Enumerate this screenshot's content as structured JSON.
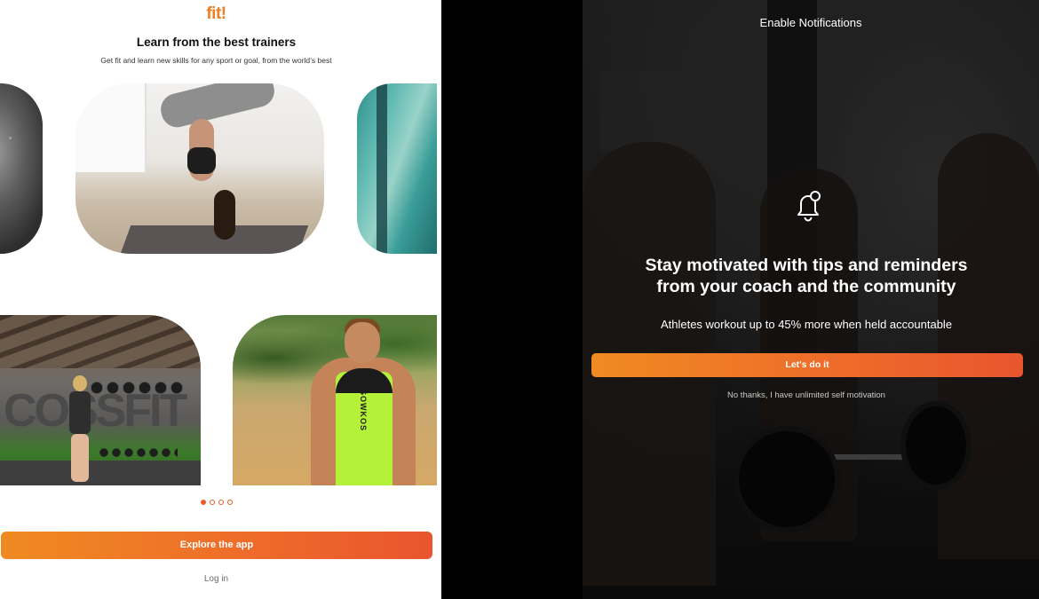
{
  "onboarding": {
    "logo": "fit!",
    "headline": "Learn from the best trainers",
    "subline": "Get fit and learn new skills for any sport or goal, from the world’s best",
    "gym_wall_text": "COSSFIT",
    "runner_vest_text": "SOWKOS",
    "carousel": {
      "total_pages": 4,
      "active_page": 1
    },
    "explore_button": "Explore the app",
    "login_link": "Log in"
  },
  "notification": {
    "title": "Enable Notifications",
    "bell_icon": "bell-icon",
    "headline_line1": "Stay motivated with tips and reminders",
    "headline_line2": "from your coach and the community",
    "subline": "Athletes workout up to 45% more when held accountable",
    "confirm_button": "Let's do it",
    "decline_link": "No thanks, I have unlimited self motivation"
  },
  "colors": {
    "brand_orange": "#f07d1f",
    "gradient_start": "#f08a22",
    "gradient_end": "#e8552e",
    "dot_accent": "#ea5c2a"
  }
}
